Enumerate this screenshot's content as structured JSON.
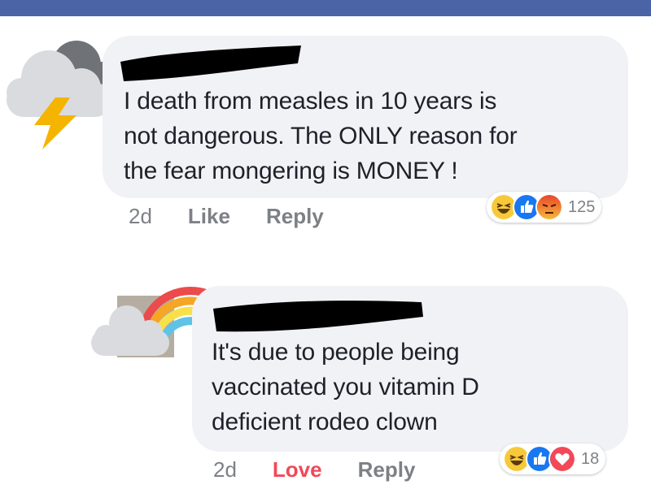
{
  "comments": [
    {
      "avatar_icon": "storm-cloud-icon",
      "text": "I death from measles in 10 years is\nnot dangerous. The ONLY reason for\nthe fear mongering is MONEY !",
      "timestamp": "2d",
      "actions": [
        "Like",
        "Reply"
      ],
      "reactions": [
        "haha-icon",
        "like-icon",
        "angry-icon"
      ],
      "reaction_count": "125"
    },
    {
      "avatar_icon": "rainbow-cloud-icon",
      "text": "It's due to people being\nvaccinated you vitamin D\ndeficient rodeo clown",
      "timestamp": "2d",
      "actions": [
        "Love",
        "Reply"
      ],
      "reactions": [
        "haha-icon",
        "like-icon",
        "love-icon"
      ],
      "reaction_count": "18"
    }
  ],
  "colors": {
    "top_bar": "#4a64a6",
    "bubble": "#f1f2f5",
    "love": "#f24858",
    "like": "#1877f2",
    "haha": "#f7c93a",
    "angry": "#e9710f"
  }
}
